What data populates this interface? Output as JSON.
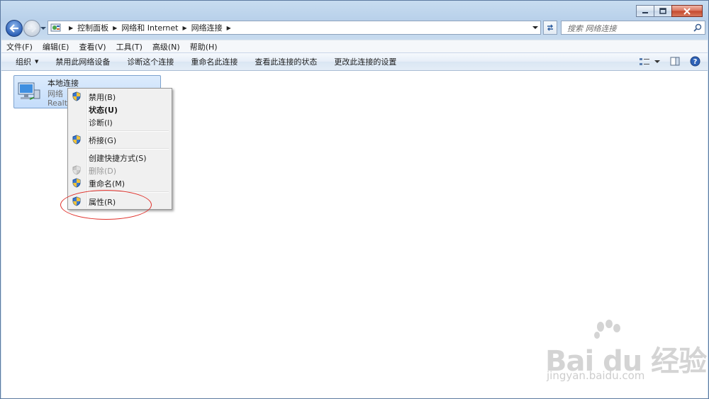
{
  "breadcrumb": [
    "控制面板",
    "网络和 Internet",
    "网络连接"
  ],
  "search": {
    "placeholder": "搜索 网络连接"
  },
  "menubar": [
    {
      "label": "文件(F)"
    },
    {
      "label": "编辑(E)"
    },
    {
      "label": "查看(V)"
    },
    {
      "label": "工具(T)"
    },
    {
      "label": "高级(N)"
    },
    {
      "label": "帮助(H)"
    }
  ],
  "toolbar": {
    "organize": "组织",
    "commands": [
      "禁用此网络设备",
      "诊断这个连接",
      "重命名此连接",
      "查看此连接的状态",
      "更改此连接的设置"
    ]
  },
  "connection": {
    "name": "本地连接",
    "status": "网络",
    "adapter": "Realte"
  },
  "context_menu": {
    "items": [
      {
        "label": "禁用(B)",
        "icon": "shield-icon"
      },
      {
        "label": "状态(U)"
      },
      {
        "label": "诊断(I)"
      },
      {
        "label": "桥接(G)",
        "icon": "shield-icon"
      },
      {
        "label": "创建快捷方式(S)"
      },
      {
        "label": "删除(D)",
        "icon": "shield-icon",
        "disabled": true
      },
      {
        "label": "重命名(M)",
        "icon": "shield-icon"
      },
      {
        "label": "属性(R)",
        "icon": "shield-icon",
        "highlighted": true
      }
    ]
  },
  "watermark": {
    "brand": "Bai du 经验",
    "url": "jingyan.baidu.com"
  },
  "colors": {
    "highlight_ellipse": "#e0302a",
    "selection": "#c4ddfb",
    "accent": "#2f63b8"
  }
}
